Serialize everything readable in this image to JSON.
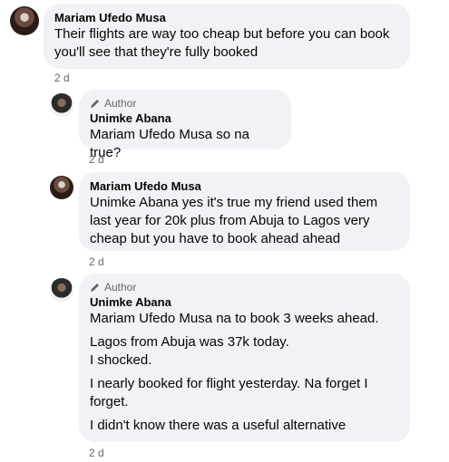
{
  "comments": [
    {
      "author": "Mariam Ufedo Musa",
      "badge": "",
      "lines": [
        "Their flights are way too cheap but before you can book",
        "you'll see that they're fully booked"
      ],
      "time": "2 d"
    },
    {
      "author": "Unimke Abana",
      "badge": "Author",
      "lines": [
        "Mariam Ufedo Musa so na true?"
      ],
      "time": "2 d"
    },
    {
      "author": "Mariam Ufedo Musa",
      "badge": "",
      "lines": [
        "Unimke Abana yes it's true my friend used them",
        "last year for 20k plus from Abuja to Lagos very",
        "cheap but you have to book ahead ahead"
      ],
      "time": "2 d"
    },
    {
      "author": "Unimke Abana",
      "badge": "Author",
      "paragraphs": [
        "Mariam Ufedo Musa na to book 3 weeks ahead.",
        "Lagos from Abuja was 37k today.\nI shocked.",
        "I nearly booked for flight yesterday. Na forget I\nforget.",
        "I didn't know there was a useful alternative"
      ],
      "time": "2 d"
    }
  ]
}
